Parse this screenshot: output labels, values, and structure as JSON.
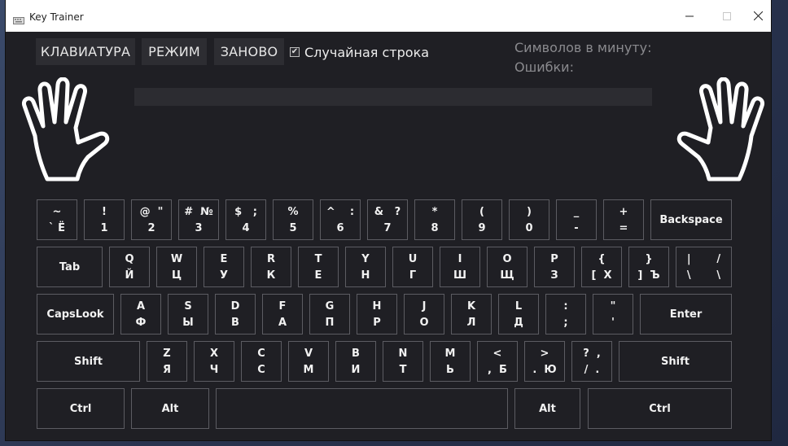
{
  "window": {
    "title": "Key Trainer"
  },
  "toolbar": {
    "keyboard_label": "КЛАВИАТУРА",
    "mode_label": "РЕЖИМ",
    "restart_label": "ЗАНОВО",
    "random_string_label": "Случайная строка",
    "random_string_checked": true
  },
  "stats": {
    "cpm_label": "Символов в минуту:",
    "errors_label": "Ошибки:"
  },
  "keyboard": {
    "rows": [
      [
        {
          "top": "~",
          "bottom": "` Ё"
        },
        {
          "top": "!",
          "bottom": "1"
        },
        {
          "top": "@  \"",
          "bottom": "2"
        },
        {
          "top": "#  №",
          "bottom": "3"
        },
        {
          "top": "$   ;",
          "bottom": "4"
        },
        {
          "top": "%",
          "bottom": "5"
        },
        {
          "top": "^    :",
          "bottom": "6"
        },
        {
          "top": "&   ?",
          "bottom": "7"
        },
        {
          "top": "*",
          "bottom": "8"
        },
        {
          "top": "(",
          "bottom": "9"
        },
        {
          "top": ")",
          "bottom": "0"
        },
        {
          "top": "_",
          "bottom": "-"
        },
        {
          "top": "+",
          "bottom": "="
        },
        {
          "label": "Backspace"
        }
      ],
      [
        {
          "label": "Tab"
        },
        {
          "top": "Q",
          "bottom": "Й"
        },
        {
          "top": "W",
          "bottom": "Ц"
        },
        {
          "top": "E",
          "bottom": "У"
        },
        {
          "top": "R",
          "bottom": "К"
        },
        {
          "top": "T",
          "bottom": "Е"
        },
        {
          "top": "Y",
          "bottom": "Н"
        },
        {
          "top": "U",
          "bottom": "Г"
        },
        {
          "top": "I",
          "bottom": "Ш"
        },
        {
          "top": "O",
          "bottom": "Щ"
        },
        {
          "top": "P",
          "bottom": "З"
        },
        {
          "top": "{",
          "bottom": "[  Х"
        },
        {
          "top": "}",
          "bottom": "]  Ъ"
        },
        {
          "top": "|       /",
          "bottom": "\\       \\"
        }
      ],
      [
        {
          "label": "CapsLook"
        },
        {
          "top": "A",
          "bottom": "Ф"
        },
        {
          "top": "S",
          "bottom": "Ы"
        },
        {
          "top": "D",
          "bottom": "В"
        },
        {
          "top": "F",
          "bottom": "А"
        },
        {
          "top": "G",
          "bottom": "П"
        },
        {
          "top": "H",
          "bottom": "Р"
        },
        {
          "top": "J",
          "bottom": "О"
        },
        {
          "top": "K",
          "bottom": "Л"
        },
        {
          "top": "L",
          "bottom": "Д"
        },
        {
          "top": ":",
          "bottom": ";"
        },
        {
          "top": "\"",
          "bottom": "'"
        },
        {
          "label": "Enter"
        }
      ],
      [
        {
          "label": "Shift"
        },
        {
          "top": "Z",
          "bottom": "Я"
        },
        {
          "top": "X",
          "bottom": "Ч"
        },
        {
          "top": "C",
          "bottom": "С"
        },
        {
          "top": "V",
          "bottom": "М"
        },
        {
          "top": "B",
          "bottom": "И"
        },
        {
          "top": "N",
          "bottom": "Т"
        },
        {
          "top": "M",
          "bottom": "Ь"
        },
        {
          "top": "<",
          "bottom": ",  Б"
        },
        {
          "top": ">",
          "bottom": ".  Ю"
        },
        {
          "top": "?  ,",
          "bottom": "/  ."
        },
        {
          "label": "Shift"
        }
      ],
      [
        {
          "label": "Ctrl"
        },
        {
          "label": "Alt"
        },
        {
          "label": ""
        },
        {
          "label": "Alt"
        },
        {
          "label": "Ctrl"
        }
      ]
    ]
  },
  "icons": {
    "app": "keyboard-icon",
    "minimize": "minimize-icon",
    "maximize": "maximize-icon",
    "close": "close-icon",
    "hands": "hand-outline-icon"
  }
}
